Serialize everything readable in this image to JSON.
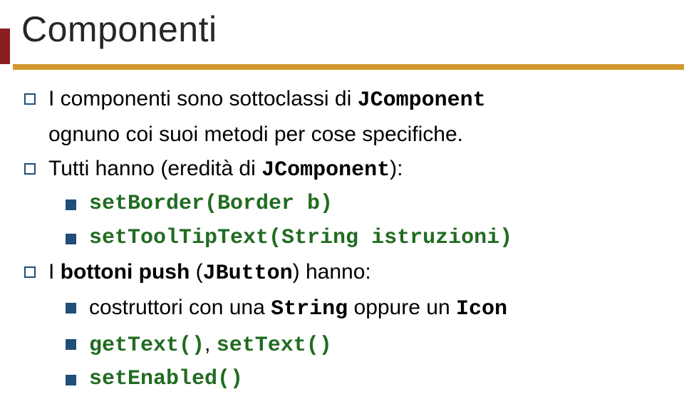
{
  "title": "Componenti",
  "b1a": "I componenti sono sottoclassi di ",
  "b1b": "JComponent",
  "b1c": "ognuno coi suoi metodi per cose specifiche.",
  "b2a": "Tutti hanno (eredità di ",
  "b2b": "JComponent",
  "b2c": "):",
  "m1": "setBorder(Border b)",
  "m2": "setToolTipText(String istruzioni)",
  "b3a": "I ",
  "b3b": "bottoni push",
  "b3c": " (",
  "b3d": "JButton",
  "b3e": ") hanno:",
  "m3a": "costruttori con una ",
  "m3b": "String",
  "m3c": " oppure un ",
  "m3d": "Icon",
  "m4a": "getText()",
  "m4b": ", ",
  "m4c": "setText()",
  "m5": "setEnabled()"
}
